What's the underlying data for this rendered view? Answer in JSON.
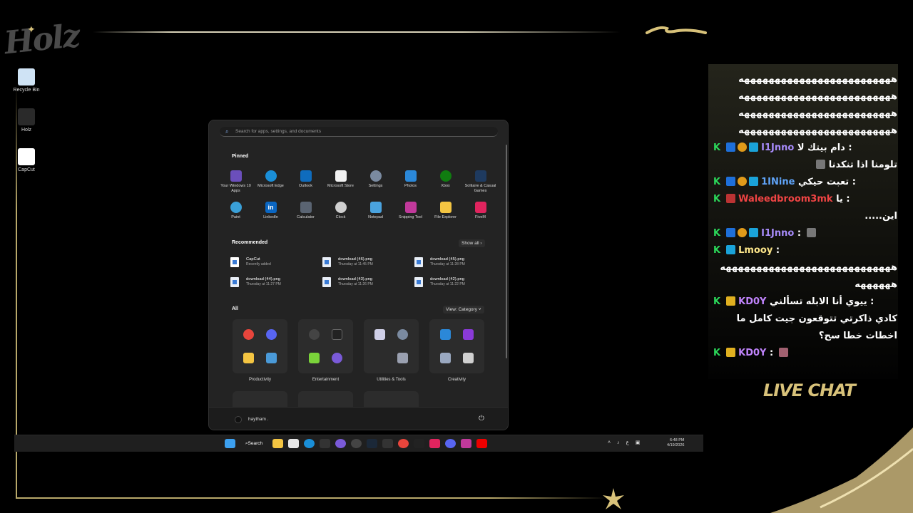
{
  "desktop": {
    "icons": [
      {
        "label": "Recycle Bin",
        "icon": "recycle-bin-icon"
      },
      {
        "label": "Holz",
        "icon": "holz-logo-icon"
      },
      {
        "label": "CapCut",
        "icon": "capcut-icon"
      }
    ]
  },
  "start_menu": {
    "search_placeholder": "Search for apps, settings, and documents",
    "pinned_title": "Pinned",
    "pinned": [
      {
        "label": "Your Windows 10 Apps",
        "color": "#6b4fbb"
      },
      {
        "label": "Microsoft Edge",
        "color": "#1a8fd8"
      },
      {
        "label": "Outlook",
        "color": "#0f6cbd"
      },
      {
        "label": "Microsoft Store",
        "color": "#f2f2f2"
      },
      {
        "label": "Settings",
        "color": "#7a8aa0"
      },
      {
        "label": "Photos",
        "color": "#2b88d8"
      },
      {
        "label": "Xbox",
        "color": "#107c10"
      },
      {
        "label": "Solitaire & Casual Games",
        "color": "#1e3a5f"
      },
      {
        "label": "Paint",
        "color": "#3aa0d8"
      },
      {
        "label": "LinkedIn",
        "color": "#0a66c2"
      },
      {
        "label": "Calculator",
        "color": "#5a6472"
      },
      {
        "label": "Clock",
        "color": "#d0d0d0"
      },
      {
        "label": "Notepad",
        "color": "#4aa3df"
      },
      {
        "label": "Snipping Tool",
        "color": "#c1399b"
      },
      {
        "label": "File Explorer",
        "color": "#f4c542"
      },
      {
        "label": "FiveM",
        "color": "#e0245e"
      }
    ],
    "recommended_title": "Recommended",
    "show_all": "Show all",
    "recommended": [
      {
        "name": "CapCut",
        "sub": "Recently added"
      },
      {
        "name": "download (46).png",
        "sub": "Thursday at 11:45 PM"
      },
      {
        "name": "download (45).png",
        "sub": "Thursday at 11:28 PM"
      },
      {
        "name": "download (44).png",
        "sub": "Thursday at 11:27 PM"
      },
      {
        "name": "download (43).png",
        "sub": "Thursday at 11:26 PM"
      },
      {
        "name": "download (42).png",
        "sub": "Thursday at 11:22 PM"
      }
    ],
    "all_title": "All",
    "view_label": "View: Category",
    "categories": [
      {
        "label": "Productivity",
        "colors": [
          "#e8453c",
          "#5865f2",
          "#f4c542",
          "#4a9ad8"
        ]
      },
      {
        "label": "Entertainment",
        "colors": [
          "#444444",
          "#222222",
          "#7ad33a",
          "#7a5ad8"
        ]
      },
      {
        "label": "Utilities & Tools",
        "colors": [
          "#d0d0e8",
          "#7a8aa0",
          "#2c2c2c",
          "#9aa0b0"
        ]
      },
      {
        "label": "Creativity",
        "colors": [
          "#2b88d8",
          "#8a3ad8",
          "#9aa8c0",
          "#d0d0d0"
        ]
      }
    ],
    "user": "haytham .",
    "power_icon": "power-icon"
  },
  "taskbar": {
    "search_label": "Search",
    "time": "6:48 PM",
    "date": "4/19/2026",
    "tray_lang": "ع"
  },
  "chat": {
    "messages": [
      {
        "text": "هههههههههههههههههههههههههه"
      },
      {
        "text": "هههههههههههههههههههههههههه"
      },
      {
        "text": "هههههههههههههههههههههههههه"
      },
      {
        "text": "هههههههههههههههههههههههههه"
      },
      {
        "user": "I1Jnno",
        "user_color": "#a78bfa",
        "text": "دام بيتك لا :"
      },
      {
        "text": "تلومنا اذا تنكدنا"
      },
      {
        "user": "1INine",
        "user_color": "#60a5fa",
        "text": "تعبت حيكي :"
      },
      {
        "user": "Waleedbroom3mk",
        "user_color": "#ef4444",
        "text": "يا :"
      },
      {
        "text": "اين....."
      },
      {
        "user": "I1Jnno",
        "user_color": "#a78bfa",
        "text": ":"
      },
      {
        "user": "Lmooy",
        "user_color": "#fde68a",
        "text": ":"
      },
      {
        "text": "ههههههههههههههههههههههههههههه"
      },
      {
        "text": "ههههههه"
      },
      {
        "user": "KD0Y",
        "user_color": "#c084fc",
        "text": "ييوي أنا الابله تسألني :"
      },
      {
        "text": "كادي ذاكرتي تتوقعون جيت كامل ما"
      },
      {
        "text": "اخطات خطا سح؟"
      },
      {
        "user": "KD0Y",
        "user_color": "#c084fc",
        "text": ":"
      }
    ],
    "live_label": "LIVE CHAT"
  }
}
